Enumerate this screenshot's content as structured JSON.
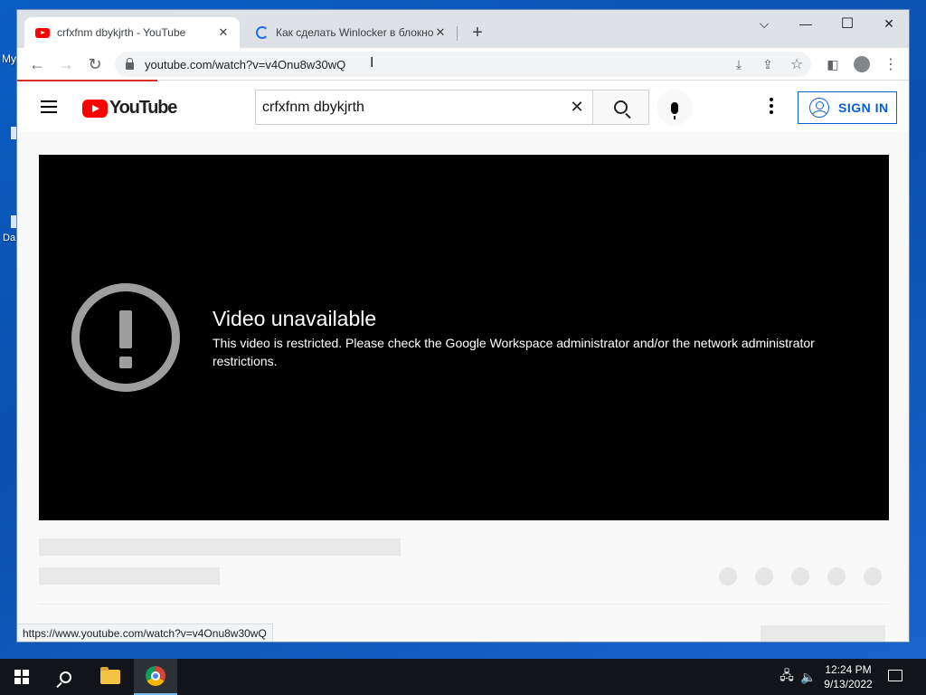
{
  "desktop": {
    "labels": [
      "My",
      "Da"
    ]
  },
  "tabs": [
    {
      "title": "crfxfnm dbykjrth - YouTube",
      "favicon": "youtube-favicon-icon",
      "active": true
    },
    {
      "title": "Как сделать Winlocker в блокнот",
      "favicon": "loading-spinner-icon",
      "active": false
    }
  ],
  "window_controls": {
    "dropdown": "⌵",
    "minimize": "—",
    "maximize": "☐",
    "close": "✕"
  },
  "toolbar": {
    "url": "youtube.com/watch?v=v4Onu8w30wQ",
    "back": "←",
    "forward": "→",
    "reload": "↻"
  },
  "youtube": {
    "logo_text": "YouTube",
    "search_value": "crfxfnm dbykjrth",
    "clear": "✕",
    "sign_in": "SIGN IN",
    "accent": "#065fd4",
    "brand_red": "#ff0000"
  },
  "player": {
    "error_title": "Video unavailable",
    "error_message": "This video is restricted. Please check the Google Workspace administrator and/or the network administrator restrictions."
  },
  "status_bar": {
    "link": "https://www.youtube.com/watch?v=v4Onu8w30wQ"
  },
  "taskbar": {
    "time": "12:24 PM",
    "date": "9/13/2022"
  }
}
